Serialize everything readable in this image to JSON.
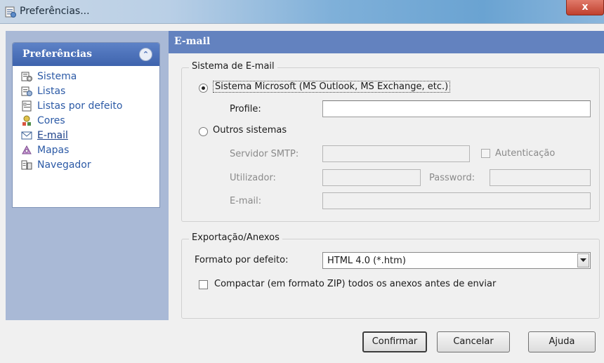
{
  "window": {
    "title": "Preferências...",
    "close_glyph": "x"
  },
  "sidebar": {
    "header": "Preferências",
    "collapse_glyph": "⌃",
    "items": [
      {
        "label": "Sistema",
        "icon": "system-icon"
      },
      {
        "label": "Listas",
        "icon": "lists-icon"
      },
      {
        "label": "Listas por defeito",
        "icon": "default-lists-icon"
      },
      {
        "label": "Cores",
        "icon": "colors-icon"
      },
      {
        "label": "E-mail",
        "icon": "envelope-icon",
        "active": true
      },
      {
        "label": "Mapas",
        "icon": "maps-icon"
      },
      {
        "label": "Navegador",
        "icon": "navigator-icon"
      }
    ]
  },
  "section": {
    "title": "E-mail"
  },
  "email_system": {
    "legend": "Sistema de E-mail",
    "option_ms": "Sistema Microsoft (MS Outlook, MS Exchange, etc.)",
    "profile_label": "Profile:",
    "profile_value": "",
    "option_other": "Outros sistemas",
    "smtp_label": "Servidor SMTP:",
    "smtp_value": "",
    "auth_label": "Autenticação",
    "user_label": "Utilizador:",
    "user_value": "",
    "password_label": "Password:",
    "password_value": "",
    "email_label": "E-mail:",
    "email_value": "",
    "selected": "ms"
  },
  "export": {
    "legend": "Exportação/Anexos",
    "format_label": "Formato por defeito:",
    "format_value": "HTML 4.0 (*.htm)",
    "zip_label": "Compactar (em formato ZIP) todos os anexos antes de enviar",
    "zip_checked": false
  },
  "buttons": {
    "confirm": "Confirmar",
    "cancel": "Cancelar",
    "help": "Ajuda"
  }
}
